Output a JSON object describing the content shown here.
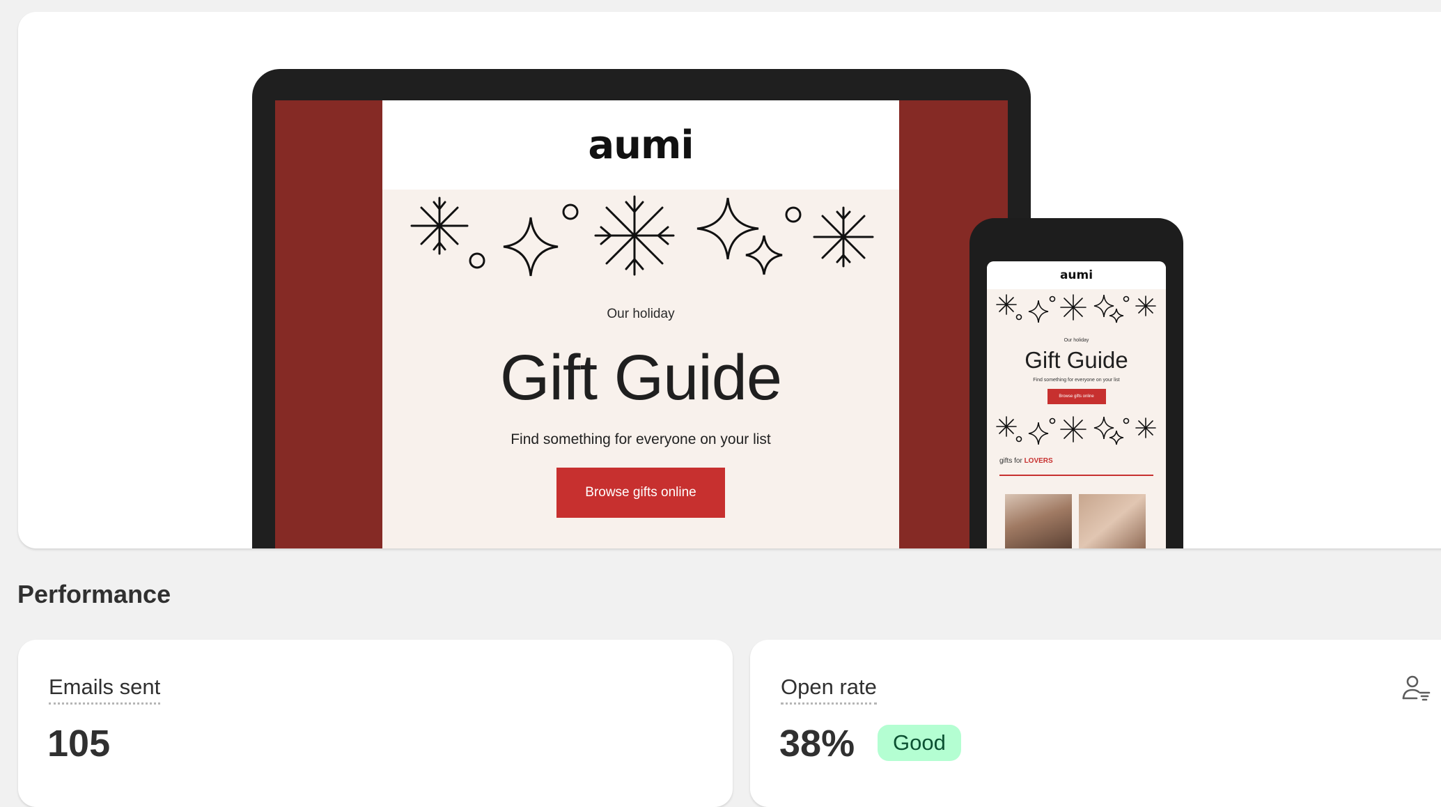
{
  "email_preview": {
    "brand": "aumi",
    "eyebrow": "Our holiday",
    "headline": "Gift Guide",
    "subline": "Find something for everyone on your list",
    "cta_label": "Browse gifts online",
    "mobile": {
      "brand": "aumi",
      "eyebrow": "Our holiday",
      "headline": "Gift Guide",
      "subline": "Find something for everyone on your list",
      "cta_label": "Browse gifts online",
      "section_prefix": "gifts for",
      "section_accent": "LOVERS"
    },
    "colors": {
      "brand_red": "#c7302f",
      "side_band": "#852a25",
      "email_bg": "#f8f1ec"
    }
  },
  "performance": {
    "title": "Performance",
    "metrics": [
      {
        "label": "Emails sent",
        "value": "105"
      },
      {
        "label": "Open rate",
        "value": "38%",
        "badge": "Good",
        "badge_color": "#b4fed2",
        "icon": "audience-filter-icon"
      }
    ]
  }
}
